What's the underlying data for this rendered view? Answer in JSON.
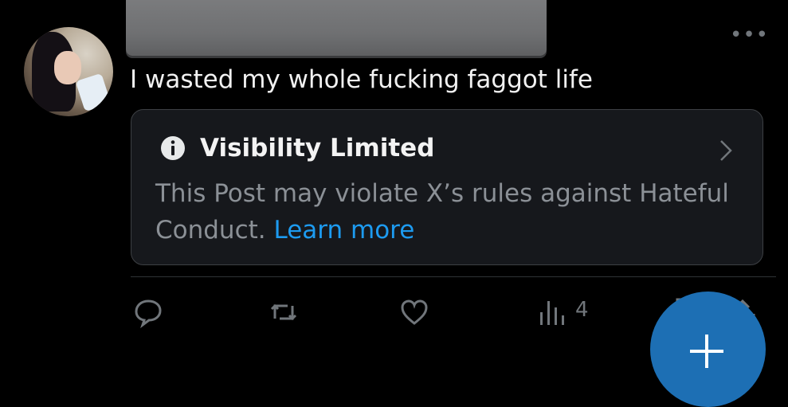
{
  "post": {
    "text": "I wasted my whole fucking faggot life",
    "more_glyph": "•••"
  },
  "notice": {
    "title": "Visibility Limited",
    "body": "This Post may violate X’s rules against Hateful Conduct.",
    "link": "Learn more",
    "icon": "info-icon"
  },
  "actions": {
    "reply_icon": "reply-icon",
    "repost_icon": "repost-icon",
    "like_icon": "like-icon",
    "views_icon": "views-icon",
    "views_count": "4",
    "bookmark_icon": "bookmark-icon",
    "share_icon": "share-icon"
  },
  "fab": {
    "icon": "plus-icon"
  },
  "colors": {
    "background": "#000000",
    "link": "#1d9bf0",
    "muted": "#71767b",
    "fab": "#1d6fb4"
  }
}
